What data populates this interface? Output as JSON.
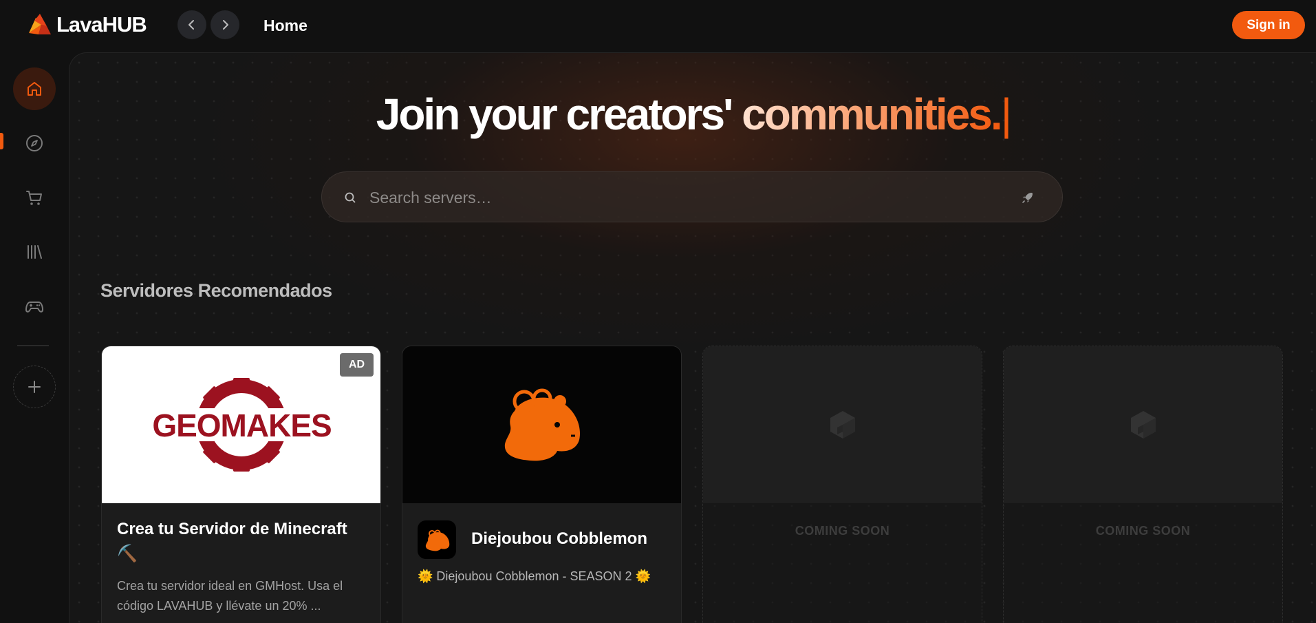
{
  "app": {
    "name": "LavaHUB",
    "brand_color": "#f25a0f"
  },
  "header": {
    "back_icon": "chevron-left-icon",
    "forward_icon": "chevron-right-icon",
    "page_title": "Home",
    "signin_label": "Sign in"
  },
  "sidebar": {
    "items": [
      {
        "name": "home",
        "icon": "home-icon",
        "active": true
      },
      {
        "name": "explore",
        "icon": "compass-icon",
        "active": false
      },
      {
        "name": "store",
        "icon": "cart-icon",
        "active": false
      },
      {
        "name": "library",
        "icon": "library-icon",
        "active": false
      },
      {
        "name": "games",
        "icon": "gamepad-icon",
        "active": false
      }
    ],
    "add_icon": "plus-icon"
  },
  "hero": {
    "title_prefix": "Join your creators'",
    "title_accent": "communities.",
    "caret": "|"
  },
  "search": {
    "placeholder": "Search servers…",
    "value": ""
  },
  "recommended": {
    "title": "Servidores Recomendados",
    "cards": [
      {
        "badge": "AD",
        "logo_text": "GEOMAKES",
        "title": "Crea tu Servidor de Minecraft ⛏️",
        "description": "Crea tu servidor ideal en GMHost. Usa el código LAVAHUB y llévate un 20% ..."
      },
      {
        "title": "Diejoubou Cobblemon",
        "description": "🌞 Diejoubou Cobblemon - SEASON 2 🌞"
      },
      {
        "status": "COMING SOON"
      },
      {
        "status": "COMING SOON"
      }
    ]
  }
}
